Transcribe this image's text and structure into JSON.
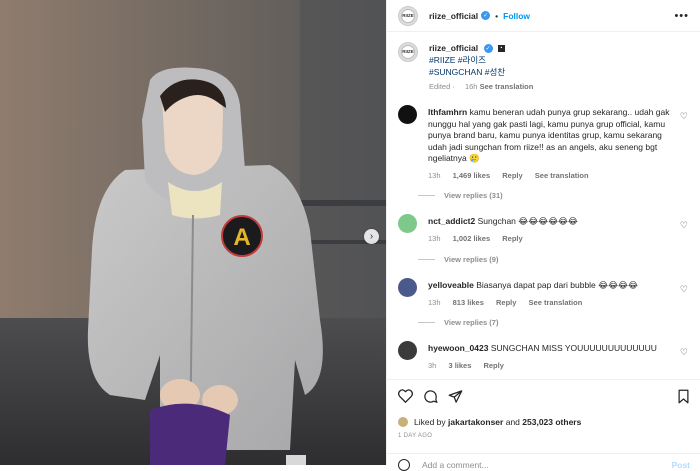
{
  "post_header": {
    "username": "riize_official",
    "separator": "•",
    "follow_label": "Follow",
    "more_label": "•••",
    "avatar_text": "RIIZE"
  },
  "caption": {
    "username": "riize_official",
    "line1": "#RIIZE #라이즈",
    "line2": "#SUNGCHAN #성찬",
    "edited": "Edited",
    "time": "16h",
    "see_translation": "See translation"
  },
  "comments": [
    {
      "username": "lthfamhrn",
      "text": "kamu beneran udah punya grup sekarang.. udah gak nunggu hal yang gak pasti lagi, kamu punya grup official, kamu punya brand baru, kamu punya identitas grup, kamu sekarang udah jadi sungchan from riize!! as an angels, aku seneng bgt ngeliatnya 🥲",
      "time": "13h",
      "likes": "1,469 likes",
      "reply": "Reply",
      "see_translation": "See translation",
      "view_replies": "View replies (31)",
      "avatar_color": "#111111"
    },
    {
      "username": "nct_addict2",
      "text": "Sungchan 😂😂😂😂😂😂",
      "time": "13h",
      "likes": "1,002 likes",
      "reply": "Reply",
      "view_replies": "View replies (9)",
      "avatar_color": "#7cc98a"
    },
    {
      "username": "yelloveable",
      "text": "Biasanya dapat pap dari bubble 😂😂😂😂",
      "time": "13h",
      "likes": "813 likes",
      "reply": "Reply",
      "see_translation": "See translation",
      "view_replies": "View replies (7)",
      "avatar_color": "#4a5a8a"
    },
    {
      "username": "hyewoon_0423",
      "text": "SUNGCHAN MISS YOUUUUUUUUUUUUU",
      "time": "3h",
      "likes": "3 likes",
      "reply": "Reply",
      "avatar_color": "#3b3b3b"
    }
  ],
  "actions": {
    "liked_by_prefix": "Liked by",
    "liked_by_user": "jakartakonser",
    "and": "and",
    "others": "253,023 others",
    "date": "1 DAY AGO",
    "add_comment_placeholder": "Add a comment...",
    "post_label": "Post"
  },
  "photo": {
    "next_icon": "chevron-right-icon",
    "patch_letter": "A"
  },
  "colors": {
    "accent": "#0095f6",
    "verified": "#3897f0",
    "hashtag": "#00376b"
  }
}
